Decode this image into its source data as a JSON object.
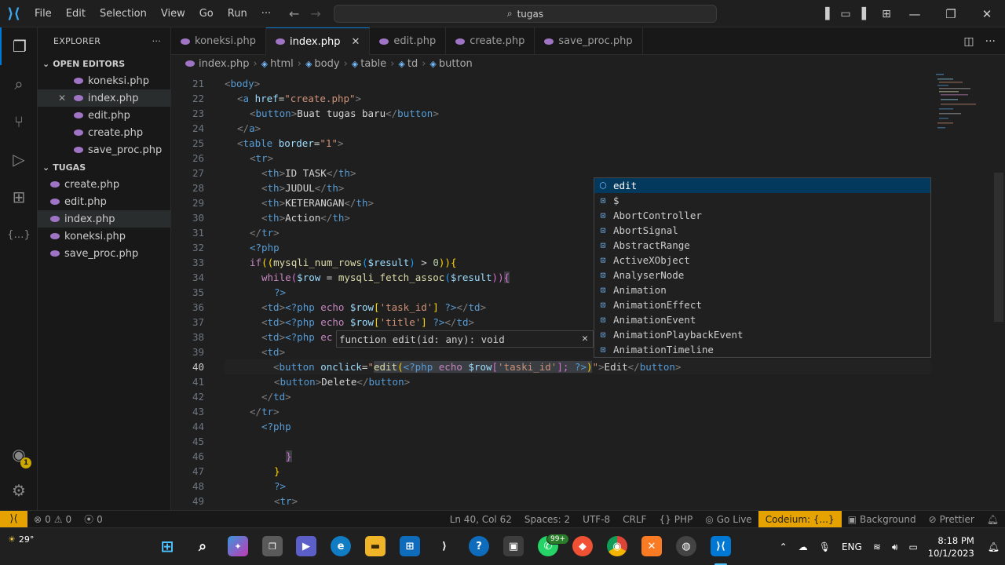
{
  "titlebar": {
    "menu": [
      "File",
      "Edit",
      "Selection",
      "View",
      "Go",
      "Run",
      "···"
    ],
    "search": "tugas"
  },
  "sidebar": {
    "title": "EXPLORER",
    "open_editors_title": "OPEN EDITORS",
    "open_editors": [
      "koneksi.php",
      "index.php",
      "edit.php",
      "create.php",
      "save_proc.php"
    ],
    "folder_title": "TUGAS",
    "folder_files": [
      "create.php",
      "edit.php",
      "index.php",
      "koneksi.php",
      "save_proc.php"
    ],
    "badge": "1"
  },
  "tabs": [
    {
      "label": "koneksi.php",
      "active": false
    },
    {
      "label": "index.php",
      "active": true
    },
    {
      "label": "edit.php",
      "active": false
    },
    {
      "label": "create.php",
      "active": false
    },
    {
      "label": "save_proc.php",
      "active": false
    }
  ],
  "breadcrumb": [
    "index.php",
    "html",
    "body",
    "table",
    "td",
    "button"
  ],
  "editor": {
    "line_numbers": [
      "21",
      "22",
      "23",
      "24",
      "25",
      "26",
      "27",
      "28",
      "29",
      "30",
      "31",
      "32",
      "33",
      "34",
      "35",
      "36",
      "37",
      "38",
      "39",
      "40",
      "41",
      "42",
      "43",
      "44",
      "45",
      "46",
      "47",
      "48",
      "49"
    ],
    "current_line": "40",
    "code": {
      "l21": [
        "<",
        "body",
        ">"
      ],
      "l22": [
        "<",
        "a",
        " href",
        "=",
        "\"create.php\"",
        ">"
      ],
      "l23": [
        "<",
        "button",
        ">",
        "Buat tugas baru",
        "</",
        "button",
        ">"
      ],
      "l24": [
        "</",
        "a",
        ">"
      ],
      "l25": [
        "<",
        "table",
        " border",
        "=",
        "\"1\"",
        ">"
      ],
      "l26": [
        "<",
        "tr",
        ">"
      ],
      "l27": [
        "<",
        "th",
        ">",
        "ID TASK",
        "</",
        "th",
        ">"
      ],
      "l28": [
        "<",
        "th",
        ">",
        "JUDUL",
        "</",
        "th",
        ">"
      ],
      "l29": [
        "<",
        "th",
        ">",
        "KETERANGAN",
        "</",
        "th",
        ">"
      ],
      "l30": [
        "<",
        "th",
        ">",
        "Action",
        "</",
        "th",
        ">"
      ],
      "l31": [
        "</",
        "tr",
        ">"
      ],
      "l32": [
        "<?php"
      ],
      "l33": [
        "if",
        "((",
        "mysqli_num_rows",
        "(",
        "$result",
        ")",
        " > ",
        "0",
        "))",
        "{"
      ],
      "l34": [
        "while",
        "(",
        "$row",
        " = ",
        "mysqli_fetch_assoc",
        "(",
        "$result",
        "))",
        "{"
      ],
      "l35": [
        "?>"
      ],
      "l36": [
        "<",
        "td",
        ">",
        "<?php",
        " echo ",
        "$row",
        "[",
        "'task_id'",
        "]",
        " ",
        "?>",
        "</",
        "td",
        ">"
      ],
      "l37": [
        "<",
        "td",
        ">",
        "<?php",
        " echo ",
        "$row",
        "[",
        "'title'",
        "]",
        " ",
        "?>",
        "</",
        "td",
        ">"
      ],
      "l38": [
        "<",
        "td",
        ">",
        "<?php",
        " ec"
      ],
      "l39": [
        "<",
        "td",
        ">"
      ],
      "l40": [
        "<",
        "button",
        " onclick",
        "=",
        "\"",
        "edit",
        "(",
        "<?php",
        " echo ",
        "$row",
        "[",
        "'taski_id'",
        "];",
        " ?>",
        ")",
        "\"",
        ">",
        "Edit",
        "</",
        "button",
        ">"
      ],
      "l41": [
        "<",
        "button",
        ">",
        "Delete",
        "</",
        "button",
        ">"
      ],
      "l42": [
        "</",
        "td",
        ">"
      ],
      "l43": [
        "</",
        "tr",
        ">"
      ],
      "l44": [
        "<?php"
      ],
      "l46": [
        "}"
      ],
      "l47": [
        "}"
      ],
      "l48": [
        "?>"
      ],
      "l49": [
        "<",
        "tr",
        ">"
      ]
    }
  },
  "suggest": [
    "edit",
    "$",
    "AbortController",
    "AbortSignal",
    "AbstractRange",
    "ActiveXObject",
    "AnalyserNode",
    "Animation",
    "AnimationEffect",
    "AnimationEvent",
    "AnimationPlaybackEvent",
    "AnimationTimeline"
  ],
  "param_hint": "function edit(id: any): void",
  "statusbar": {
    "errors": "0",
    "warnings": "0",
    "ports": "0",
    "position": "Ln 40, Col 62",
    "spaces": "Spaces: 2",
    "encoding": "UTF-8",
    "eol": "CRLF",
    "language": "PHP",
    "golive": "Go Live",
    "codeium": "Codeium: {...}",
    "background": "Background",
    "prettier": "Prettier"
  },
  "taskbar": {
    "weather": "29°",
    "lang": "ENG",
    "time": "8:18 PM",
    "date": "10/1/2023",
    "whatsapp_badge": "99+"
  },
  "colors": {
    "accent": "#0078d4",
    "status_warning": "#e5a200",
    "suggest_selected": "#04395e"
  }
}
